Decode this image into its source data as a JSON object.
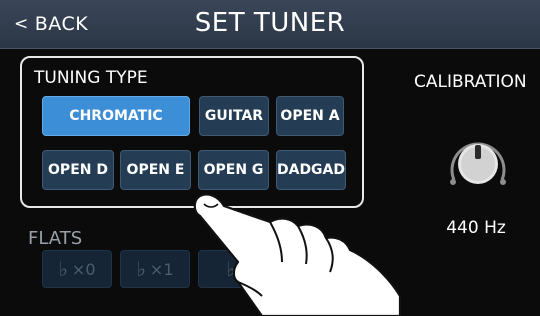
{
  "header": {
    "back_label": "BACK",
    "back_icon": "chevron-left",
    "title": "SET TUNER"
  },
  "tuning_type": {
    "label": "TUNING TYPE",
    "selected": "CHROMATIC",
    "options": [
      "CHROMATIC",
      "GUITAR",
      "OPEN A",
      "OPEN D",
      "OPEN E",
      "OPEN G",
      "DADGAD"
    ]
  },
  "calibration": {
    "label": "CALIBRATION",
    "value": "440 Hz"
  },
  "flats": {
    "label": "FLATS",
    "options": [
      {
        "symbol": "♭",
        "text": "×0"
      },
      {
        "symbol": "♭",
        "text": "×1"
      },
      {
        "symbol": "♭",
        "text": ""
      }
    ]
  },
  "colors": {
    "header": "#2f3b4c",
    "button": "#243d55",
    "selected_button": "#3c8ed6",
    "disabled_button": "#152536"
  }
}
